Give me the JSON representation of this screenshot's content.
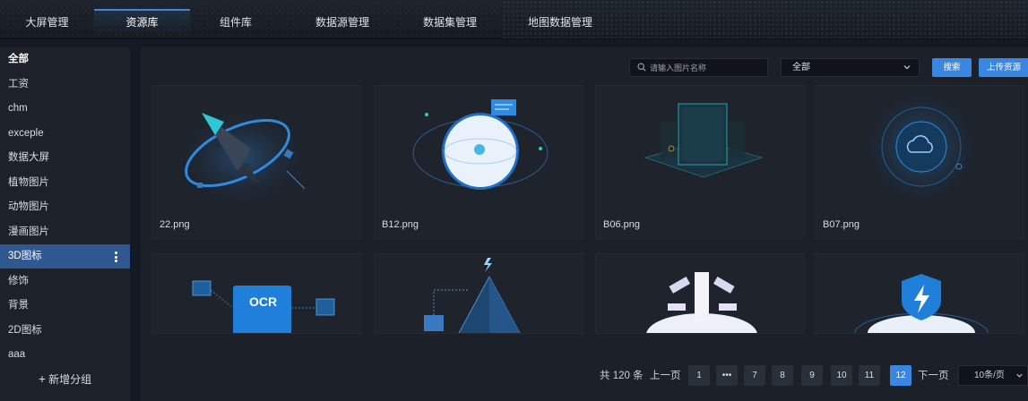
{
  "topnav": {
    "tabs": [
      {
        "label": "大屏管理"
      },
      {
        "label": "资源库"
      },
      {
        "label": "组件库"
      },
      {
        "label": "数据源管理"
      },
      {
        "label": "数据集管理"
      },
      {
        "label": "地图数据管理"
      }
    ],
    "active_index": 1
  },
  "sidebar": {
    "items": [
      {
        "label": "全部"
      },
      {
        "label": "工资"
      },
      {
        "label": "chm"
      },
      {
        "label": "exceple"
      },
      {
        "label": "数据大屏"
      },
      {
        "label": "植物图片"
      },
      {
        "label": "动物图片"
      },
      {
        "label": "漫画图片"
      },
      {
        "label": "3D图标"
      },
      {
        "label": "修饰"
      },
      {
        "label": "背景"
      },
      {
        "label": "2D图标"
      },
      {
        "label": "aaa"
      }
    ],
    "active_index": 8,
    "add_group_label": "新增分组"
  },
  "toolbar": {
    "search_placeholder": "请输入图片名称",
    "category_value": "全部",
    "search_button": "搜索",
    "upload_button": "上传资源"
  },
  "cards": [
    {
      "name": "22.png"
    },
    {
      "name": "B12.png"
    },
    {
      "name": "B06.png"
    },
    {
      "name": "B07.png"
    }
  ],
  "pagination": {
    "total": "共 120 条",
    "prev": "上一页",
    "next": "下一页",
    "pages": [
      "1",
      "•••",
      "7",
      "8",
      "9",
      "10",
      "11",
      "12"
    ],
    "active_page": "12",
    "page_size": "10条/页"
  },
  "colors": {
    "accent": "#3a86e0",
    "sidebar_active": "#2f5890",
    "background": "#141a23"
  }
}
